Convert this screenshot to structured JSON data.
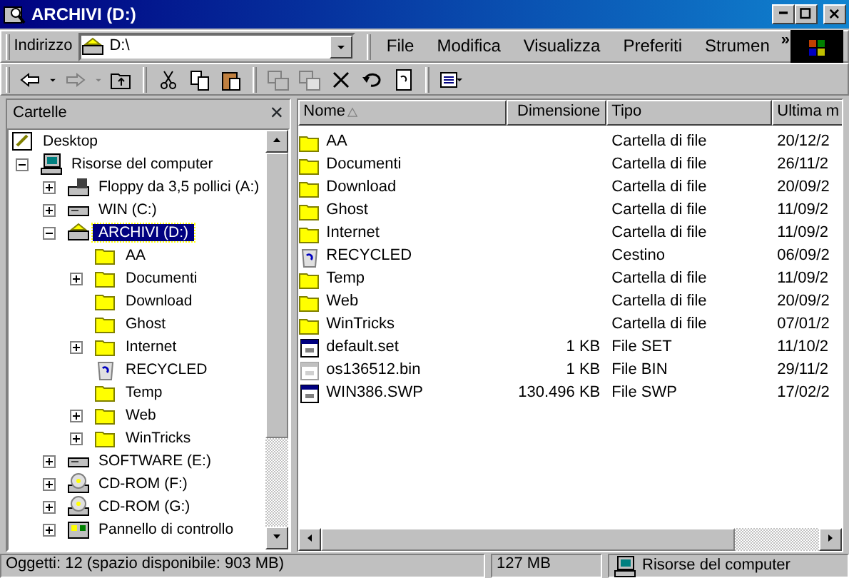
{
  "window": {
    "title": "ARCHIVI (D:)"
  },
  "address": {
    "label": "Indirizzo",
    "value": "D:\\"
  },
  "menu": [
    "File",
    "Modifica",
    "Visualizza",
    "Preferiti",
    "Strumen"
  ],
  "menu_more": "»",
  "folders_pane": {
    "title": "Cartelle",
    "close": "×",
    "tree": [
      {
        "label": "Desktop",
        "kind": "desktop",
        "selected": false,
        "children": [
          {
            "label": "Risorse del computer",
            "kind": "computer",
            "selected": false,
            "expanded": true,
            "children": [
              {
                "label": "Floppy da 3,5 pollici (A:)",
                "kind": "floppy",
                "selected": false,
                "expanded": false
              },
              {
                "label": "WIN (C:)",
                "kind": "drive",
                "selected": false,
                "expanded": false
              },
              {
                "label": "ARCHIVI (D:)",
                "kind": "drive-open",
                "selected": true,
                "expanded": true,
                "children": [
                  {
                    "label": "AA",
                    "kind": "folder",
                    "selected": false
                  },
                  {
                    "label": "Documenti",
                    "kind": "folder",
                    "selected": false,
                    "expanded": false
                  },
                  {
                    "label": "Download",
                    "kind": "folder",
                    "selected": false
                  },
                  {
                    "label": "Ghost",
                    "kind": "folder",
                    "selected": false
                  },
                  {
                    "label": "Internet",
                    "kind": "folder",
                    "selected": false,
                    "expanded": false
                  },
                  {
                    "label": "RECYCLED",
                    "kind": "recycle",
                    "selected": false
                  },
                  {
                    "label": "Temp",
                    "kind": "folder",
                    "selected": false
                  },
                  {
                    "label": "Web",
                    "kind": "folder",
                    "selected": false,
                    "expanded": false
                  },
                  {
                    "label": "WinTricks",
                    "kind": "folder",
                    "selected": false,
                    "expanded": false
                  }
                ]
              },
              {
                "label": "SOFTWARE (E:)",
                "kind": "drive",
                "selected": false,
                "expanded": false
              },
              {
                "label": "CD-ROM (F:)",
                "kind": "cdrom",
                "selected": false,
                "expanded": false
              },
              {
                "label": "CD-ROM (G:)",
                "kind": "cdrom",
                "selected": false,
                "expanded": false
              },
              {
                "label": "Pannello di controllo",
                "kind": "control-panel",
                "selected": false,
                "expanded": false
              }
            ]
          }
        ]
      }
    ]
  },
  "files": {
    "columns": [
      "Nome",
      "Dimensione",
      "Tipo",
      "Ultima m"
    ],
    "rows": [
      {
        "name": "AA",
        "size": "",
        "type": "Cartella di file",
        "date": "20/12/2",
        "kind": "folder"
      },
      {
        "name": "Documenti",
        "size": "",
        "type": "Cartella di file",
        "date": "26/11/2",
        "kind": "folder"
      },
      {
        "name": "Download",
        "size": "",
        "type": "Cartella di file",
        "date": "20/09/2",
        "kind": "folder"
      },
      {
        "name": "Ghost",
        "size": "",
        "type": "Cartella di file",
        "date": "11/09/2",
        "kind": "folder"
      },
      {
        "name": "Internet",
        "size": "",
        "type": "Cartella di file",
        "date": "11/09/2",
        "kind": "folder"
      },
      {
        "name": "RECYCLED",
        "size": "",
        "type": "Cestino",
        "date": "06/09/2",
        "kind": "recycle"
      },
      {
        "name": "Temp",
        "size": "",
        "type": "Cartella di file",
        "date": "11/09/2",
        "kind": "folder"
      },
      {
        "name": "Web",
        "size": "",
        "type": "Cartella di file",
        "date": "20/09/2",
        "kind": "folder"
      },
      {
        "name": "WinTricks",
        "size": "",
        "type": "Cartella di file",
        "date": "07/01/2",
        "kind": "folder"
      },
      {
        "name": "default.set",
        "size": "1 KB",
        "type": "File SET",
        "date": "11/10/2",
        "kind": "file"
      },
      {
        "name": "os136512.bin",
        "size": "1 KB",
        "type": "File BIN",
        "date": "29/11/2",
        "kind": "file-hidden"
      },
      {
        "name": "WIN386.SWP",
        "size": "130.496 KB",
        "type": "File SWP",
        "date": "17/02/2",
        "kind": "file"
      }
    ]
  },
  "status_bar": [
    "Oggetti: 12 (spazio disponibile: 903 MB)",
    "127 MB",
    "Risorse del computer"
  ]
}
